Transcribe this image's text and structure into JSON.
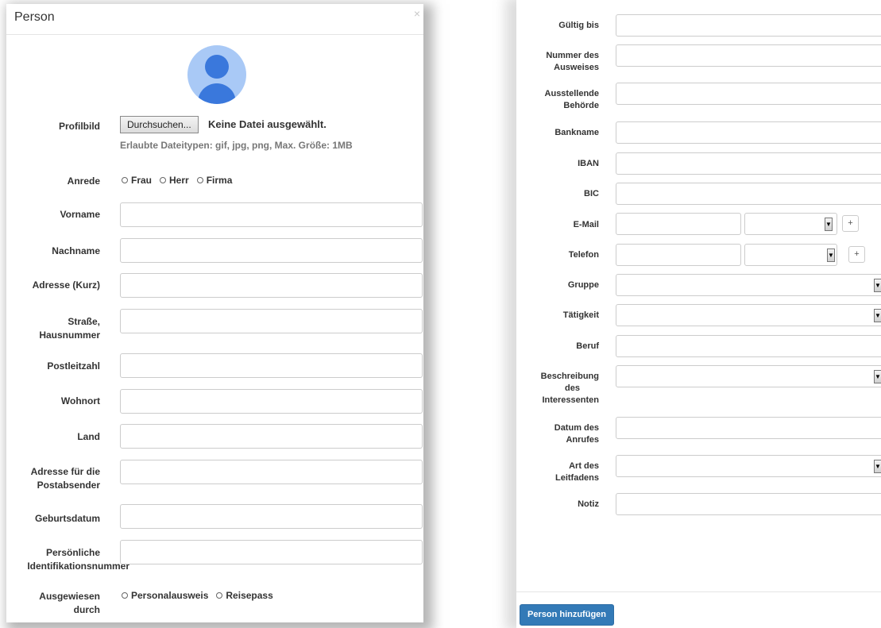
{
  "left": {
    "title": "Person",
    "close": "×",
    "profile_label": "Profilbild",
    "file_button": "Durchsuchen...",
    "file_none": "Keine Datei ausgewählt.",
    "file_hint": "Erlaubte Dateitypen: gif, jpg, png, Max. Größe: 1MB",
    "salutation_label": "Anrede",
    "salutation_options": [
      "Frau",
      "Herr",
      "Firma"
    ],
    "fields": {
      "vorname": "Vorname",
      "nachname": "Nachname",
      "adresse_kurz": "Adresse (Kurz)",
      "strasse_1": "Straße,",
      "strasse_2": "Hausnummer",
      "plz": "Postleitzahl",
      "wohnort": "Wohnort",
      "land": "Land",
      "postabsender_1": "Adresse für die",
      "postabsender_2": "Postabsender",
      "geburtsdatum": "Geburtsdatum",
      "pid_1": "Persönliche",
      "pid_2": "Identifikationsnummer"
    },
    "id_label_1": "Ausgewiesen",
    "id_label_2": "durch",
    "id_options": [
      "Personalausweis",
      "Reisepass"
    ]
  },
  "right": {
    "gueltig_bis": "Gültig bis",
    "nummer_1": "Nummer des",
    "nummer_2": "Ausweises",
    "behoerde_1": "Ausstellende",
    "behoerde_2": "Behörde",
    "bankname": "Bankname",
    "iban": "IBAN",
    "bic": "BIC",
    "email": "E-Mail",
    "telefon": "Telefon",
    "gruppe": "Gruppe",
    "taetigkeit": "Tätigkeit",
    "beruf": "Beruf",
    "beschreibung_1": "Beschreibung",
    "beschreibung_2": "des",
    "beschreibung_3": "Interessenten",
    "datum_1": "Datum des",
    "datum_2": "Anrufes",
    "art_1": "Art des",
    "art_2": "Leitfadens",
    "notiz": "Notiz",
    "plus": "+",
    "submit": "Person hinzufügen"
  }
}
